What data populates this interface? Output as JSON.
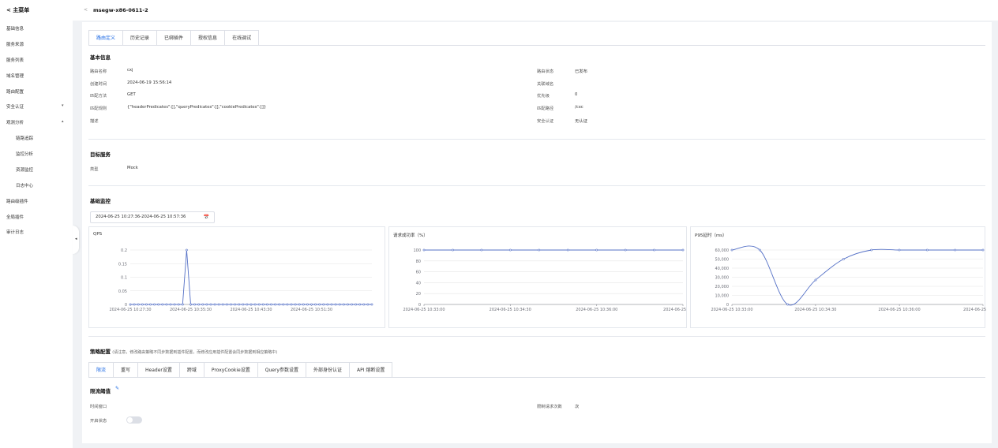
{
  "sidebar": {
    "back_label": "< 主菜单",
    "items": [
      {
        "label": "基础信息"
      },
      {
        "label": "服务来源"
      },
      {
        "label": "服务列表"
      },
      {
        "label": "域名管理"
      },
      {
        "label": "路由配置"
      },
      {
        "label": "安全认证",
        "chevron": "▾"
      },
      {
        "label": "观测分析",
        "chevron": "▴"
      },
      {
        "label": "链路追踪"
      },
      {
        "label": "监控分析"
      },
      {
        "label": "资源监控"
      },
      {
        "label": "日志中心"
      },
      {
        "label": "路由级插件"
      },
      {
        "label": "全局插件"
      },
      {
        "label": "审计日志"
      }
    ],
    "collapse_glyph": "◂"
  },
  "header": {
    "back_glyph": "<",
    "title": "msegw-x86-0611-2"
  },
  "tabs": [
    "路由定义",
    "历史记录",
    "已绑插件",
    "授权信息",
    "在线调试"
  ],
  "basic": {
    "title": "基本信息",
    "left": [
      {
        "label": "路由名称",
        "value": "cxj"
      },
      {
        "label": "创建时间",
        "value": "2024-06-19 15:56:14"
      },
      {
        "label": "匹配方法",
        "value": "GET"
      },
      {
        "label": "匹配规则",
        "value": "{\"headerPredicates\":[],\"queryPredicates\":[],\"cookiePredicates\":[]}"
      },
      {
        "label": "描述",
        "value": ""
      }
    ],
    "right": [
      {
        "label": "路由状态",
        "value": "已发布"
      },
      {
        "label": "关联域名",
        "value": ""
      },
      {
        "label": "优先级",
        "value": "0"
      },
      {
        "label": "匹配路径",
        "value": "/cxc"
      },
      {
        "label": "安全认证",
        "value": "无认证"
      }
    ]
  },
  "target": {
    "title": "目标服务",
    "type_label": "类型",
    "type_value": "Mock"
  },
  "monitor": {
    "title": "基础监控",
    "date_range": "2024-06-25 10:27:36-2024-06-25 10:57:36",
    "calendar_icon": "📅"
  },
  "chart_data": [
    {
      "type": "line",
      "title": "QPS",
      "x_tick_labels": [
        "2024-06-25 10:27:30",
        "2024-06-25 10:35:30",
        "2024-06-25 10:43:30",
        "2024-06-25 10:51:30"
      ],
      "y_ticks": [
        "0",
        "0.05",
        "0.1",
        "0.15",
        "0.2"
      ],
      "ylim": [
        0,
        0.2
      ],
      "color": "#5470c6",
      "series": [
        {
          "values": [
            0,
            0,
            0,
            0,
            0,
            0,
            0,
            0,
            0,
            0,
            0,
            0,
            0,
            0,
            0.2,
            0,
            0,
            0,
            0,
            0,
            0,
            0,
            0,
            0,
            0,
            0,
            0,
            0,
            0,
            0,
            0,
            0,
            0,
            0,
            0,
            0,
            0,
            0,
            0,
            0,
            0,
            0,
            0,
            0,
            0,
            0,
            0,
            0,
            0,
            0,
            0,
            0,
            0,
            0,
            0,
            0,
            0,
            0,
            0,
            0,
            0
          ]
        }
      ]
    },
    {
      "type": "line",
      "title": "请求成功率（%）",
      "x_tick_labels": [
        "2024-06-25 10:33:00",
        "2024-06-25 10:34:30",
        "2024-06-25 10:36:00",
        "2024-06-25 10:37:3"
      ],
      "y_ticks": [
        "0",
        "20",
        "40",
        "60",
        "80",
        "100"
      ],
      "ylim": [
        0,
        100
      ],
      "color": "#5470c6",
      "series": [
        {
          "values": [
            100,
            100,
            100,
            100,
            100,
            100,
            100,
            100,
            100,
            100
          ]
        }
      ]
    },
    {
      "type": "line",
      "title": "P95延时（ms）",
      "x_tick_labels": [
        "2024-06-25 10:33:00",
        "2024-06-25 10:34:30",
        "2024-06-25 10:36:00",
        "2024-06-25 10:37:3"
      ],
      "y_ticks": [
        "0",
        "10,000",
        "20,000",
        "30,000",
        "40,000",
        "50,000",
        "60,000"
      ],
      "ylim": [
        0,
        60000
      ],
      "color": "#5470c6",
      "series": [
        {
          "values": [
            60000,
            60000,
            0,
            27000,
            50000,
            60000,
            60000,
            60000,
            60000,
            60000
          ]
        }
      ]
    }
  ],
  "strategy": {
    "title": "策略配置",
    "note": "(请注意，修改路由策略不同步数据到插件配置，而修改应用插件配置会同步数据到相应策略中)",
    "tabs": [
      "限流",
      "重写",
      "Header设置",
      "跨域",
      "ProxyCookie设置",
      "Query参数设置",
      "外部身份认证",
      "API 熔断设置"
    ]
  },
  "ratelimit": {
    "title": "限流阈值",
    "edit_icon": "✎",
    "window_label": "时间窗口",
    "window_value": "",
    "limit_label": "限制请求次数",
    "limit_value": "次",
    "enable_label": "开启状态",
    "enabled": false
  }
}
